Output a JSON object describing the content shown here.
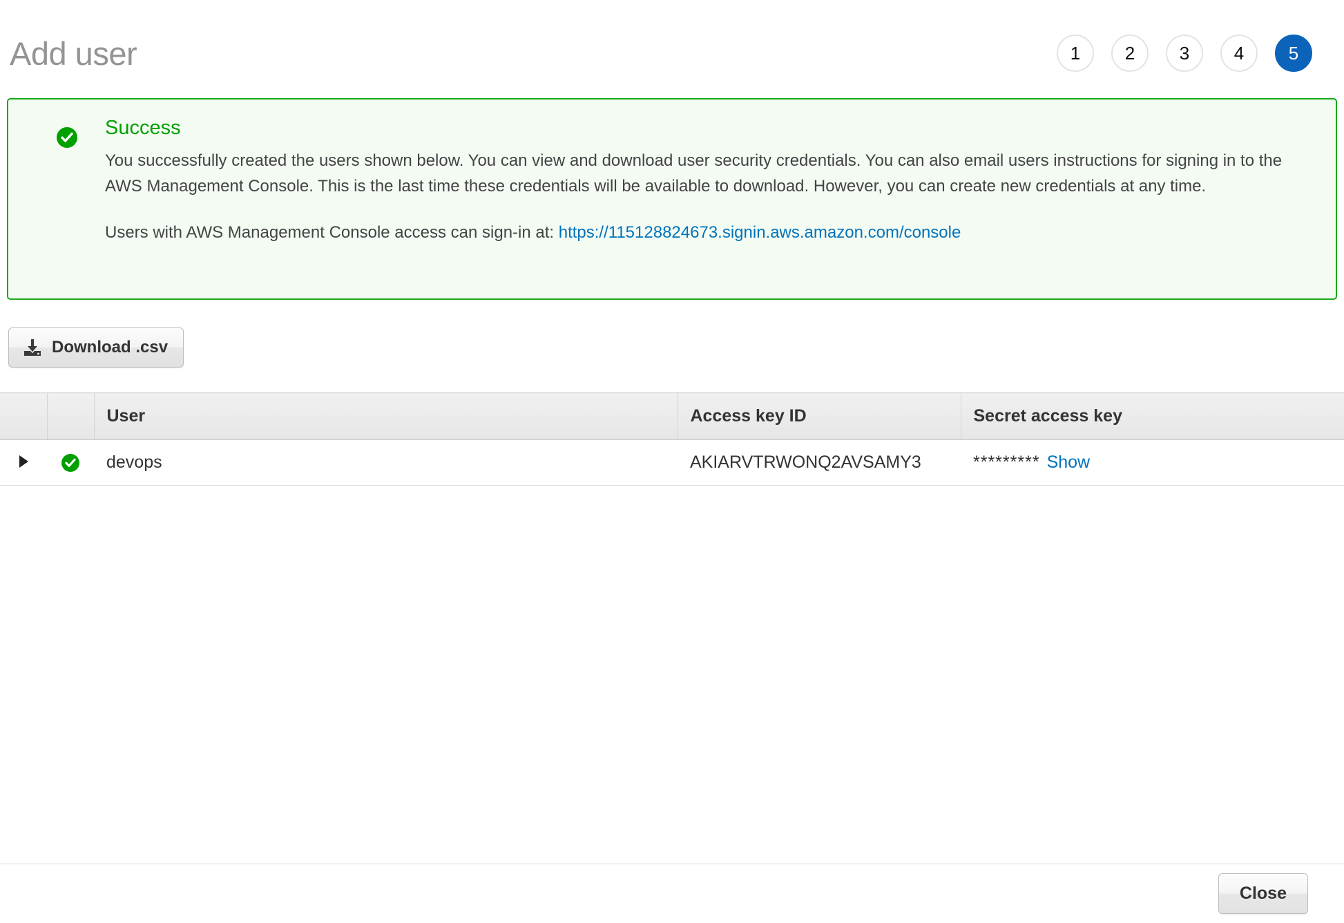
{
  "header": {
    "title": "Add user",
    "steps": [
      {
        "label": "1",
        "active": false
      },
      {
        "label": "2",
        "active": false
      },
      {
        "label": "3",
        "active": false
      },
      {
        "label": "4",
        "active": false
      },
      {
        "label": "5",
        "active": true
      }
    ]
  },
  "alert": {
    "icon": "check-circle-icon",
    "title": "Success",
    "paragraph1": "You successfully created the users shown below. You can view and download user security credentials. You can also email users instructions for signing in to the AWS Management Console. This is the last time these credentials will be available to download. However, you can create new credentials at any time.",
    "paragraph2_prefix": "Users with AWS Management Console access can sign-in at: ",
    "signin_url": "https://115128824673.signin.aws.amazon.com/console",
    "border_color": "#17a81a",
    "background_color": "#f3fbf3",
    "title_color": "#00a000",
    "link_color": "#0073bb"
  },
  "toolbar": {
    "download_label": "Download .csv",
    "download_icon": "download-icon"
  },
  "table": {
    "columns": [
      "",
      "",
      "User",
      "Access key ID",
      "Secret access key"
    ],
    "rows": [
      {
        "expand_icon": "caret-right-icon",
        "status_icon": "check-circle-icon",
        "user": "devops",
        "access_key_id": "AKIARVTRWONQ2AVSAMY3",
        "secret_access_key_mask": "*********",
        "show_label": "Show"
      }
    ]
  },
  "footer": {
    "close_label": "Close"
  },
  "colors": {
    "accent_blue": "#0b64ba",
    "link_blue": "#0073bb",
    "success_green": "#17a81a",
    "title_gray": "#949494"
  }
}
